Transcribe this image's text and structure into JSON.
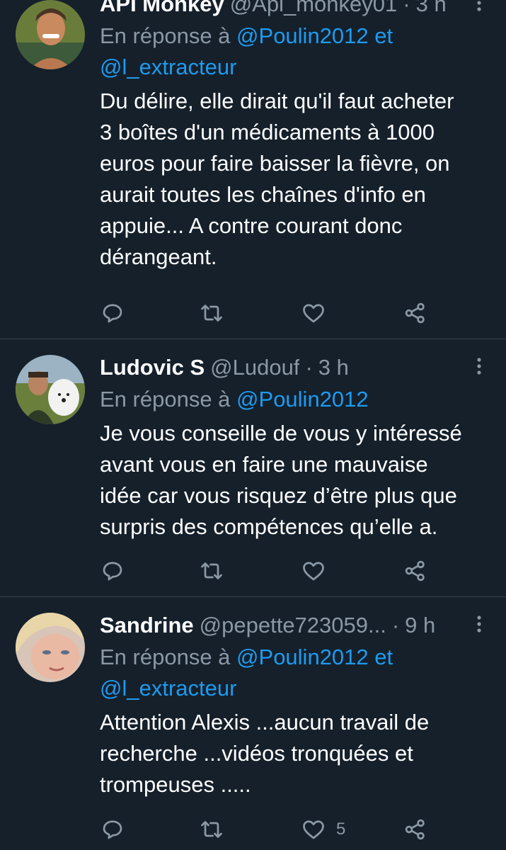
{
  "tweets": [
    {
      "name": "API Monkey",
      "handle": "@Api_monkey01",
      "dot": "·",
      "time": "3 h",
      "reply_prefix": "En réponse à",
      "reply_mention_1": "@Poulin2012",
      "reply_joiner": "et",
      "reply_mention_2": "@l_extracteur",
      "text": "Du délire, elle dirait qu'il faut acheter\n3 boîtes d'un médicaments à 1000\neuros pour faire baisser la fièvre, on\naurait toutes les chaînes d'info en\nappuie... A contre courant donc\ndérangeant.",
      "like_count": ""
    },
    {
      "name": "Ludovic S",
      "handle": "@Ludouf",
      "dot": "·",
      "time": "3 h",
      "reply_prefix": "En réponse à",
      "reply_mention_1": "@Poulin2012",
      "text": "Je vous conseille de vous y intéressé\navant vous en faire une mauvaise\nidée car vous risquez d’être plus que\nsurpris des compétences qu’elle a.",
      "like_count": ""
    },
    {
      "name": "Sandrine",
      "handle": "@pepette723059...",
      "dot": "·",
      "time": "9 h",
      "reply_prefix": "En réponse à",
      "reply_mention_1": "@Poulin2012",
      "reply_joiner": "et",
      "reply_mention_2": "@l_extracteur",
      "text": "Attention Alexis ...aucun travail de\nrecherche ...vidéos tronquées et\ntrompeuses .....",
      "like_count": "5"
    }
  ],
  "icons": {
    "reply": "reply-icon",
    "retweet": "retweet-icon",
    "like": "heart-icon",
    "share": "share-icon",
    "more": "more-vertical-icon"
  },
  "colors": {
    "background": "#15202b",
    "text": "#ffffff",
    "secondary": "#8b98a5",
    "accent": "#1d9bf0",
    "divider": "#38444d"
  }
}
